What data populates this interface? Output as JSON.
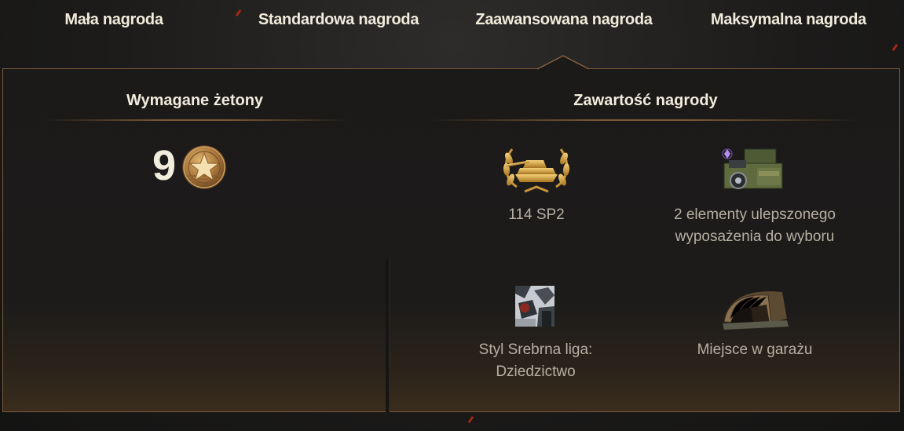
{
  "tabs": [
    {
      "label": "Mała nagroda"
    },
    {
      "label": "Standardowa nagroda"
    },
    {
      "label": "Zaawansowana nagroda",
      "active": true
    },
    {
      "label": "Maksymalna nagroda"
    }
  ],
  "left": {
    "title": "Wymagane żetony",
    "token_count": "9",
    "token_icon": "star-token-icon"
  },
  "right": {
    "title": "Zawartość nagrody",
    "rewards": [
      {
        "label": "114 SP2",
        "icon": "tank-laurel-icon"
      },
      {
        "label": "2 elementy ulepszonego\nwyposażenia do wyboru",
        "icon": "equipment-crate-icon"
      },
      {
        "label": "Styl Srebrna liga:\nDziedzictwo",
        "icon": "style-paint-icon"
      },
      {
        "label": "Miejsce w garażu",
        "icon": "garage-hangar-icon"
      }
    ]
  },
  "colors": {
    "accent_gold": "#d2a24a",
    "border": "#7a5a3a",
    "text": "#f2ecdc",
    "muted_text": "#b7b0a2"
  }
}
